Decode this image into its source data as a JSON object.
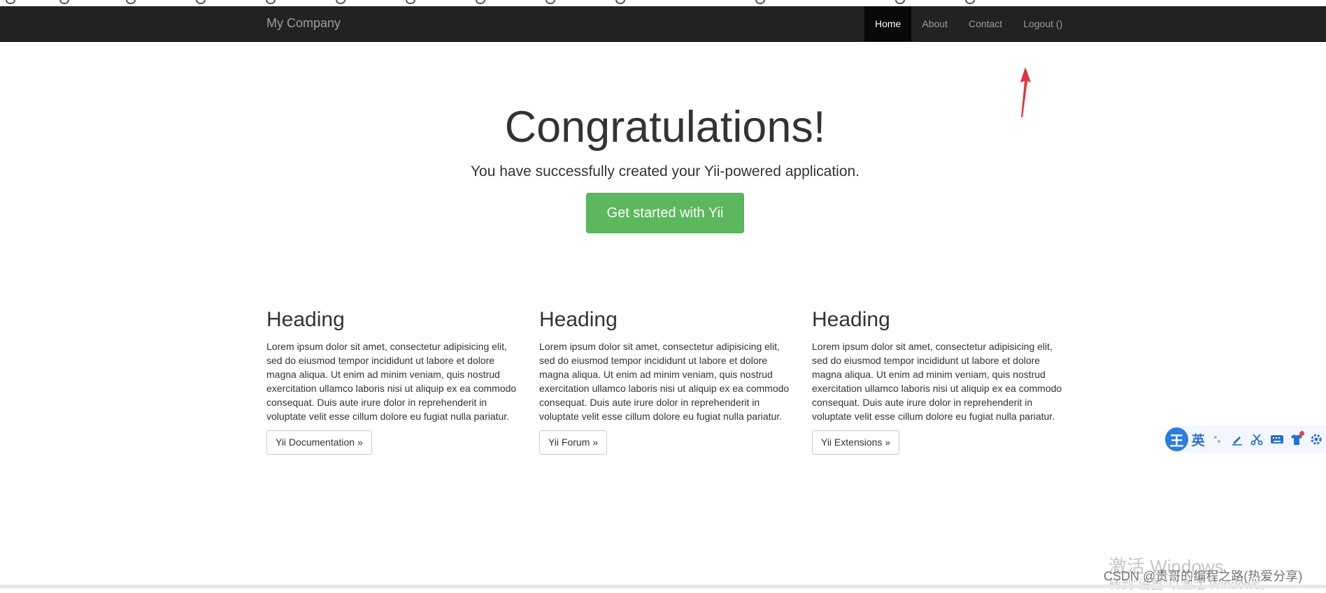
{
  "navbar": {
    "brand": "My Company",
    "items": [
      {
        "label": "Home",
        "active": true
      },
      {
        "label": "About",
        "active": false
      },
      {
        "label": "Contact",
        "active": false
      },
      {
        "label": "Logout ()",
        "active": false
      }
    ]
  },
  "jumbotron": {
    "title": "Congratulations!",
    "lead": "You have successfully created your Yii-powered application.",
    "button": "Get started with Yii"
  },
  "columns": [
    {
      "heading": "Heading",
      "text": "Lorem ipsum dolor sit amet, consectetur adipisicing elit, sed do eiusmod tempor incididunt ut labore et dolore magna aliqua. Ut enim ad minim veniam, quis nostrud exercitation ullamco laboris nisi ut aliquip ex ea commodo consequat. Duis aute irure dolor in reprehenderit in voluptate velit esse cillum dolore eu fugiat nulla pariatur.",
      "button": "Yii Documentation »"
    },
    {
      "heading": "Heading",
      "text": "Lorem ipsum dolor sit amet, consectetur adipisicing elit, sed do eiusmod tempor incididunt ut labore et dolore magna aliqua. Ut enim ad minim veniam, quis nostrud exercitation ullamco laboris nisi ut aliquip ex ea commodo consequat. Duis aute irure dolor in reprehenderit in voluptate velit esse cillum dolore eu fugiat nulla pariatur.",
      "button": "Yii Forum »"
    },
    {
      "heading": "Heading",
      "text": "Lorem ipsum dolor sit amet, consectetur adipisicing elit, sed do eiusmod tempor incididunt ut labore et dolore magna aliqua. Ut enim ad minim veniam, quis nostrud exercitation ullamco laboris nisi ut aliquip ex ea commodo consequat. Duis aute irure dolor in reprehenderit in voluptate velit esse cillum dolore eu fugiat nulla pariatur.",
      "button": "Yii Extensions »"
    }
  ],
  "ime_toolbar": {
    "logo": "王",
    "lang": "英",
    "icons": [
      "punctuation-icon",
      "pen-icon",
      "scissors-icon",
      "keyboard-icon",
      "shirt-icon",
      "gear-icon"
    ]
  },
  "watermarks": {
    "activate": "激活 Windows",
    "activate_sub": "转到\"设置\"以激活 Windows。",
    "csdn": "CSDN @贵哥的编程之路(热爱分享)"
  },
  "colors": {
    "navbar_bg": "#222222",
    "navbar_active_bg": "#080808",
    "success": "#5cb85c",
    "arrow": "#e8303a",
    "ime_blue": "#2b7de1"
  }
}
